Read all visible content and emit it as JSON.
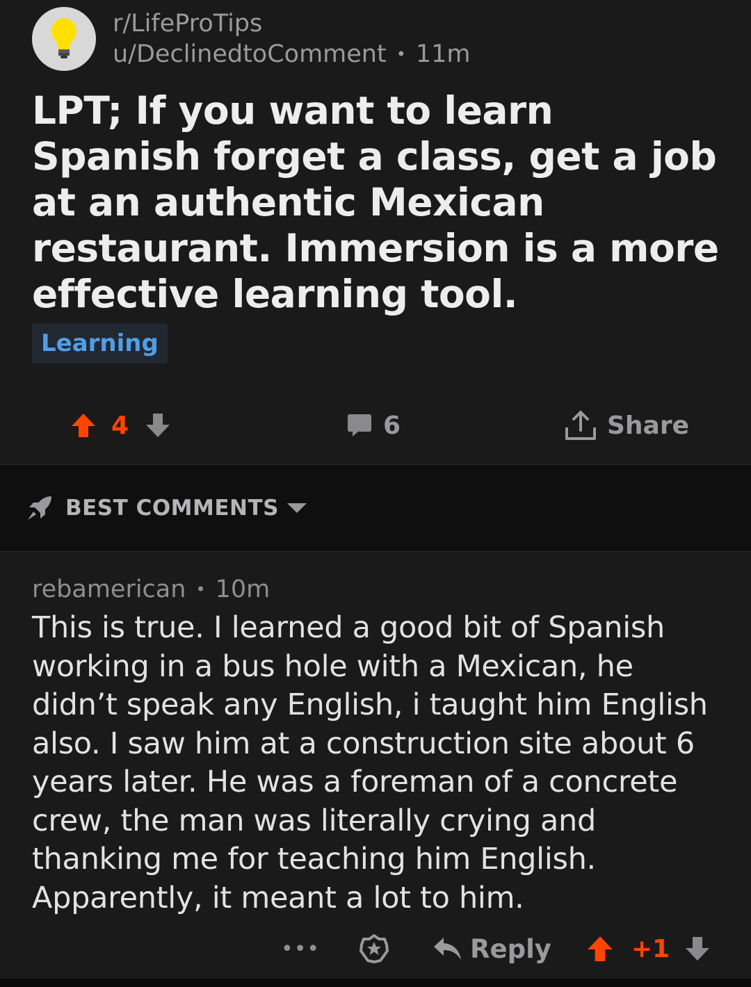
{
  "post": {
    "subreddit": "r/LifeProTips",
    "author": "u/DeclinedtoComment",
    "separator": "•",
    "age": "11m",
    "subreddit_icon": "lightbulb-icon",
    "title": "LPT; If you want to learn Spanish forget a class, get a job at an authentic Mexican restaurant. Immersion is a more effective learning tool.",
    "flair": "Learning"
  },
  "actions": {
    "vote_count": "4",
    "comment_count": "6",
    "share_label": "Share"
  },
  "sort": {
    "label": "BEST COMMENTS",
    "icon": "rocket-icon"
  },
  "comment": {
    "author": "rebamerican",
    "separator": "•",
    "age": "10m",
    "body": "This is true. I learned a good bit of Spanish working in a bus hole with a Mexican, he didn’t speak any English, i taught him English also. I saw him at a construction site about 6 years later. He was a foreman of a concrete crew, the man was literally crying and thanking me for teaching him English. Apparently, it meant a lot to him.",
    "more_label": "•••",
    "reply_label": "Reply",
    "score": "+1"
  },
  "colors": {
    "background": "#1a1a1b",
    "upvote": "#ff4500",
    "flair_text": "#4f9ee8",
    "muted": "#9a9a9c"
  }
}
